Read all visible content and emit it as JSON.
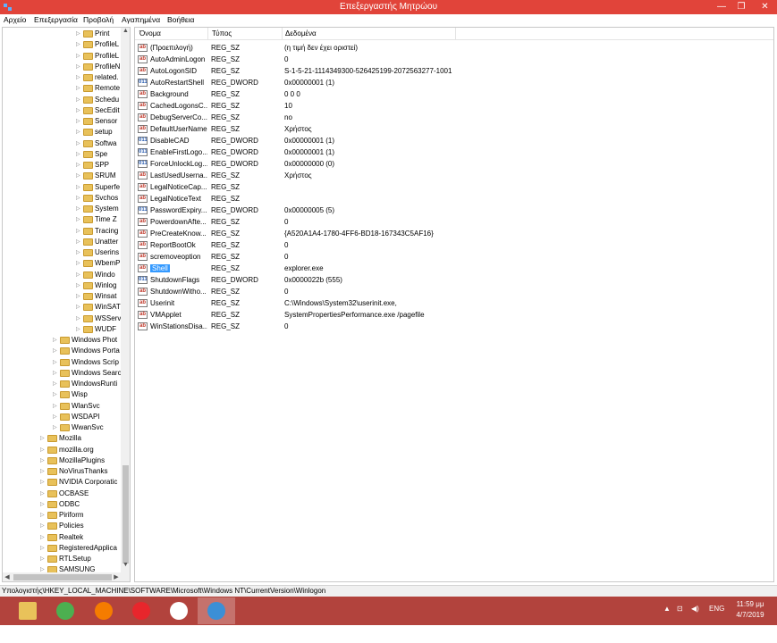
{
  "window": {
    "title": "Επεξεργαστής Μητρώου"
  },
  "menu": [
    "Αρχείο",
    "Επεξεργασία",
    "Προβολή",
    "Αγαπημένα",
    "Βοήθεια"
  ],
  "tree": [
    {
      "label": "Print",
      "level": 3
    },
    {
      "label": "ProfileL",
      "level": 3
    },
    {
      "label": "ProfileL",
      "level": 3
    },
    {
      "label": "ProfileN",
      "level": 3
    },
    {
      "label": "related.",
      "level": 3
    },
    {
      "label": "Remote",
      "level": 3
    },
    {
      "label": "Schedu",
      "level": 3
    },
    {
      "label": "SecEdit",
      "level": 3
    },
    {
      "label": "Sensor",
      "level": 3
    },
    {
      "label": "setup",
      "level": 3
    },
    {
      "label": "Softwa",
      "level": 3
    },
    {
      "label": "Spe",
      "level": 3
    },
    {
      "label": "SPP",
      "level": 3
    },
    {
      "label": "SRUM",
      "level": 3
    },
    {
      "label": "Superfe",
      "level": 3
    },
    {
      "label": "Svchos",
      "level": 3
    },
    {
      "label": "System",
      "level": 3
    },
    {
      "label": "Time Z",
      "level": 3
    },
    {
      "label": "Tracing",
      "level": 3
    },
    {
      "label": "Unatter",
      "level": 3
    },
    {
      "label": "Userins",
      "level": 3
    },
    {
      "label": "WbemP",
      "level": 3
    },
    {
      "label": "Windo",
      "level": 3
    },
    {
      "label": "Winlog",
      "level": 3
    },
    {
      "label": "Winsat",
      "level": 3
    },
    {
      "label": "WinSAT",
      "level": 3
    },
    {
      "label": "WSServ",
      "level": 3
    },
    {
      "label": "WUDF",
      "level": 3
    },
    {
      "label": "Windows Phot",
      "level": 2
    },
    {
      "label": "Windows Porta",
      "level": 2
    },
    {
      "label": "Windows Scrip",
      "level": 2
    },
    {
      "label": "Windows Searc",
      "level": 2
    },
    {
      "label": "WindowsRunti",
      "level": 2
    },
    {
      "label": "Wisp",
      "level": 2
    },
    {
      "label": "WlanSvc",
      "level": 2
    },
    {
      "label": "WSDAPI",
      "level": 2
    },
    {
      "label": "WwanSvc",
      "level": 2
    },
    {
      "label": "Mozilla",
      "level": 1
    },
    {
      "label": "mozilla.org",
      "level": 1
    },
    {
      "label": "MozillaPlugins",
      "level": 1
    },
    {
      "label": "NoVirusThanks",
      "level": 1
    },
    {
      "label": "NVIDIA Corporatic",
      "level": 1
    },
    {
      "label": "OCBASE",
      "level": 1
    },
    {
      "label": "ODBC",
      "level": 1
    },
    {
      "label": "Piriform",
      "level": 1
    },
    {
      "label": "Policies",
      "level": 1
    },
    {
      "label": "Realtek",
      "level": 1
    },
    {
      "label": "RegisteredApplica",
      "level": 1
    },
    {
      "label": "RTLSetup",
      "level": 1
    },
    {
      "label": "SAMSUNG",
      "level": 1
    }
  ],
  "columns": {
    "name": "Όνομα",
    "type": "Τύπος",
    "data": "Δεδομένα"
  },
  "values": [
    {
      "name": "(Προεπιλογή)",
      "type": "REG_SZ",
      "data": "(η τιμή δεν έχει οριστεί)",
      "kind": "sz"
    },
    {
      "name": "AutoAdminLogon",
      "type": "REG_SZ",
      "data": "0",
      "kind": "sz"
    },
    {
      "name": "AutoLogonSID",
      "type": "REG_SZ",
      "data": "S-1-5-21-1114349300-526425199-2072563277-1001",
      "kind": "sz"
    },
    {
      "name": "AutoRestartShell",
      "type": "REG_DWORD",
      "data": "0x00000001 (1)",
      "kind": "bin"
    },
    {
      "name": "Background",
      "type": "REG_SZ",
      "data": "0 0 0",
      "kind": "sz"
    },
    {
      "name": "CachedLogonsC...",
      "type": "REG_SZ",
      "data": "10",
      "kind": "sz"
    },
    {
      "name": "DebugServerCo...",
      "type": "REG_SZ",
      "data": "no",
      "kind": "sz"
    },
    {
      "name": "DefaultUserName",
      "type": "REG_SZ",
      "data": "Χρήστος",
      "kind": "sz"
    },
    {
      "name": "DisableCAD",
      "type": "REG_DWORD",
      "data": "0x00000001 (1)",
      "kind": "bin"
    },
    {
      "name": "EnableFirstLogo...",
      "type": "REG_DWORD",
      "data": "0x00000001 (1)",
      "kind": "bin"
    },
    {
      "name": "ForceUnlockLog...",
      "type": "REG_DWORD",
      "data": "0x00000000 (0)",
      "kind": "bin"
    },
    {
      "name": "LastUsedUserna...",
      "type": "REG_SZ",
      "data": "Χρήστος",
      "kind": "sz"
    },
    {
      "name": "LegalNoticeCap...",
      "type": "REG_SZ",
      "data": "",
      "kind": "sz"
    },
    {
      "name": "LegalNoticeText",
      "type": "REG_SZ",
      "data": "",
      "kind": "sz"
    },
    {
      "name": "PasswordExpiry...",
      "type": "REG_DWORD",
      "data": "0x00000005 (5)",
      "kind": "bin"
    },
    {
      "name": "PowerdownAfte...",
      "type": "REG_SZ",
      "data": "0",
      "kind": "sz"
    },
    {
      "name": "PreCreateKnow...",
      "type": "REG_SZ",
      "data": "{A520A1A4-1780-4FF6-BD18-167343C5AF16}",
      "kind": "sz"
    },
    {
      "name": "ReportBootOk",
      "type": "REG_SZ",
      "data": "0",
      "kind": "sz"
    },
    {
      "name": "scremoveoption",
      "type": "REG_SZ",
      "data": "0",
      "kind": "sz"
    },
    {
      "name": "Shell",
      "type": "REG_SZ",
      "data": "explorer.exe",
      "kind": "sz",
      "selected": true
    },
    {
      "name": "ShutdownFlags",
      "type": "REG_DWORD",
      "data": "0x0000022b (555)",
      "kind": "bin"
    },
    {
      "name": "ShutdownWitho...",
      "type": "REG_SZ",
      "data": "0",
      "kind": "sz"
    },
    {
      "name": "Userinit",
      "type": "REG_SZ",
      "data": "C:\\Windows\\System32\\userinit.exe,",
      "kind": "sz"
    },
    {
      "name": "VMApplet",
      "type": "REG_SZ",
      "data": "SystemPropertiesPerformance.exe /pagefile",
      "kind": "sz"
    },
    {
      "name": "WinStationsDisa...",
      "type": "REG_SZ",
      "data": "0",
      "kind": "sz"
    }
  ],
  "status": {
    "path": "Υπολογιστής\\HKEY_LOCAL_MACHINE\\SOFTWARE\\Microsoft\\Windows NT\\CurrentVersion\\Winlogon"
  },
  "taskbar": {
    "apps": [
      {
        "name": "file-explorer-icon",
        "color": "#e9c25a"
      },
      {
        "name": "chrome-icon",
        "color": "#4caf50"
      },
      {
        "name": "firefox-icon",
        "color": "#f57c00"
      },
      {
        "name": "opera-icon",
        "color": "#e8262c"
      },
      {
        "name": "yandex-icon",
        "color": "#ffffff"
      },
      {
        "name": "regedit-icon",
        "color": "#3b8fd6",
        "active": true
      }
    ],
    "language": "ENG",
    "time": "11:59 μμ",
    "date": "4/7/2019"
  },
  "colors": {
    "titlebar": "#e1443a",
    "taskbar": "#b2433d",
    "selection": "#3399ff"
  }
}
